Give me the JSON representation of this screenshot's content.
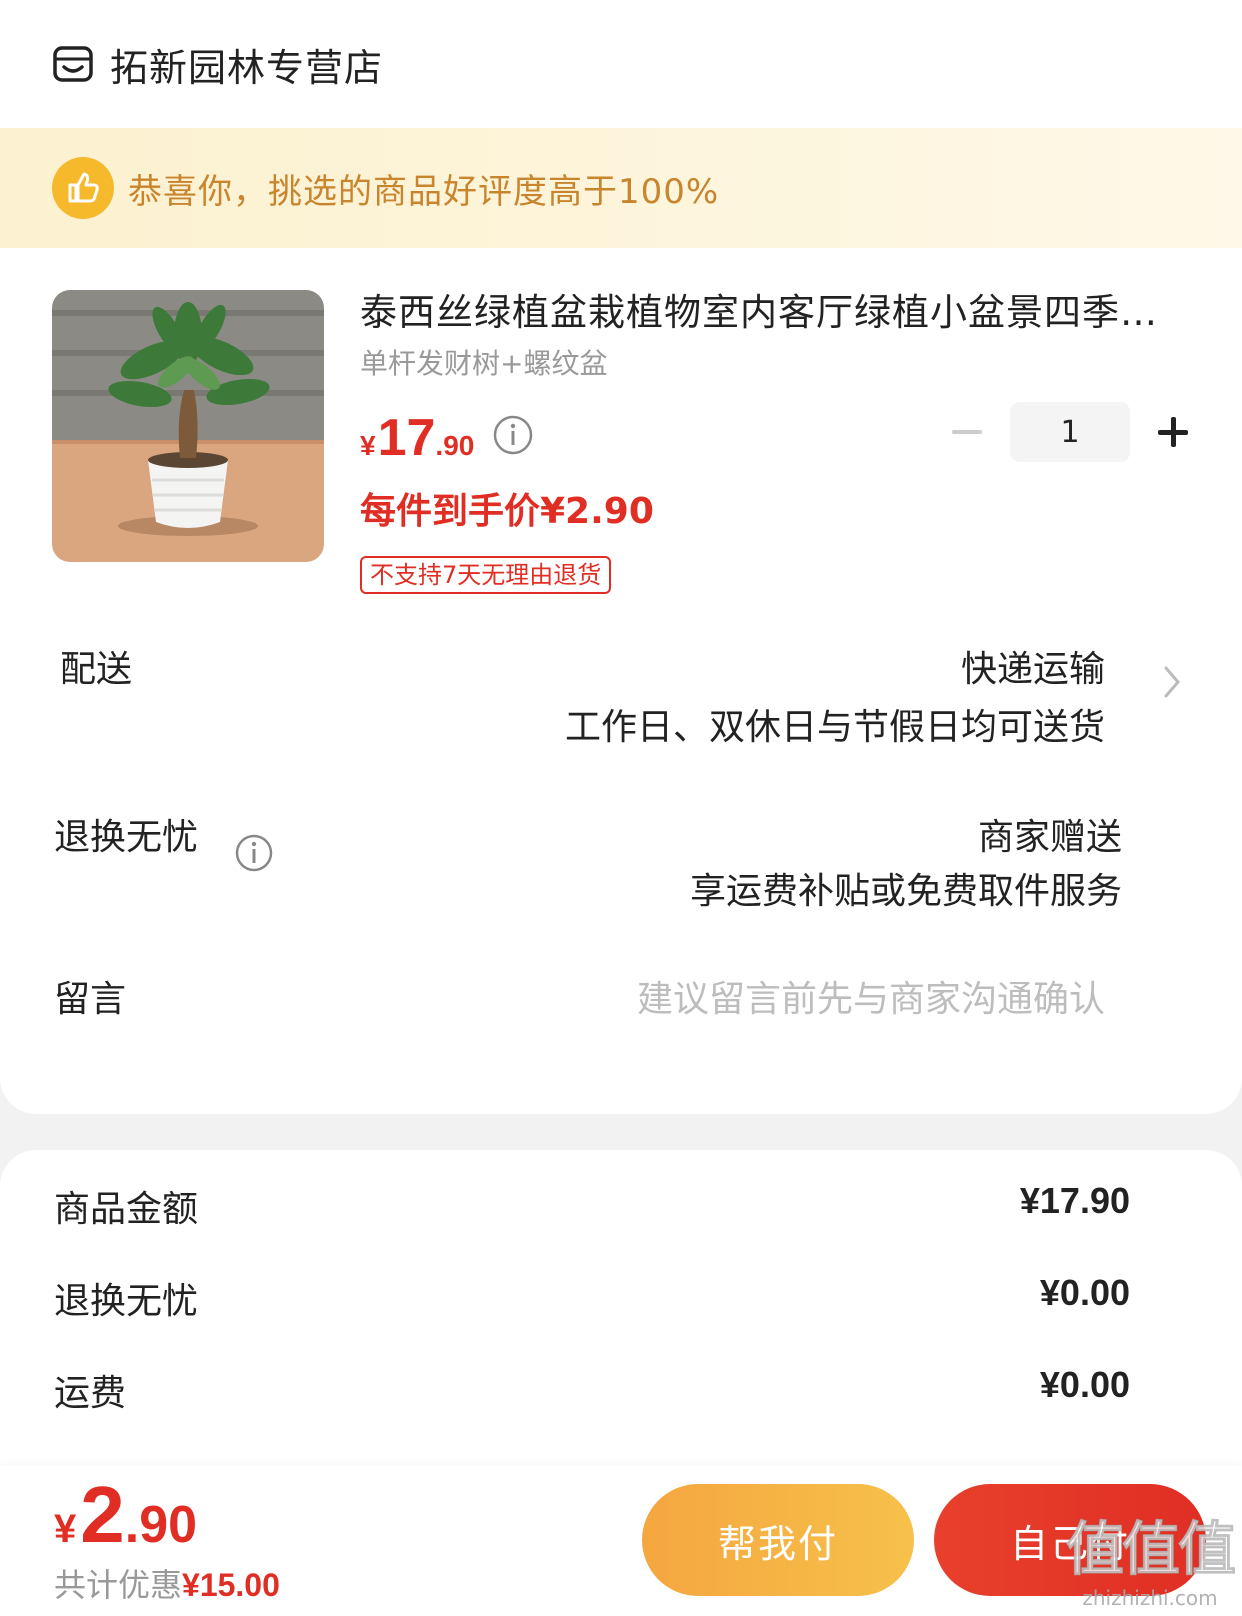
{
  "store": {
    "name": "拓新园林专营店",
    "icon": "store-icon"
  },
  "banner": {
    "text": "恭喜你，挑选的商品好评度高于100%",
    "icon": "thumbs-up-icon"
  },
  "product": {
    "title": "泰西丝绿植盆栽植物室内客厅绿植小盆景四季常青发财树",
    "spec": "单杆发财树+螺纹盆",
    "price_currency": "¥",
    "price_int": "17",
    "price_dec": ".90",
    "final_price": "每件到手价¥2.90",
    "tag": "不支持7天无理由退货",
    "quantity": "1"
  },
  "delivery": {
    "label": "配送",
    "method": "快递运输",
    "detail": "工作日、双休日与节假日均可送货"
  },
  "return_service": {
    "label": "退换无忧",
    "value": "商家赠送",
    "detail": "享运费补贴或免费取件服务"
  },
  "message": {
    "label": "留言",
    "placeholder": "建议留言前先与商家沟通确认"
  },
  "summary": [
    {
      "label": "商品金额",
      "value": "¥17.90"
    },
    {
      "label": "退换无忧",
      "value": "¥0.00"
    },
    {
      "label": "运费",
      "value": "¥0.00"
    }
  ],
  "footer": {
    "total_currency": "¥",
    "total_int": "2",
    "total_dec": ".90",
    "discount_label": "共计优惠",
    "discount_value": "¥15.00",
    "friend_pay": "帮我付",
    "self_pay": "自己付"
  },
  "watermark": {
    "main": "值值值",
    "sub": "zhizhizhi.com"
  },
  "colors": {
    "accent": "#e02e24",
    "banner_text": "#c9852e",
    "friend_btn": "#f5b545"
  }
}
